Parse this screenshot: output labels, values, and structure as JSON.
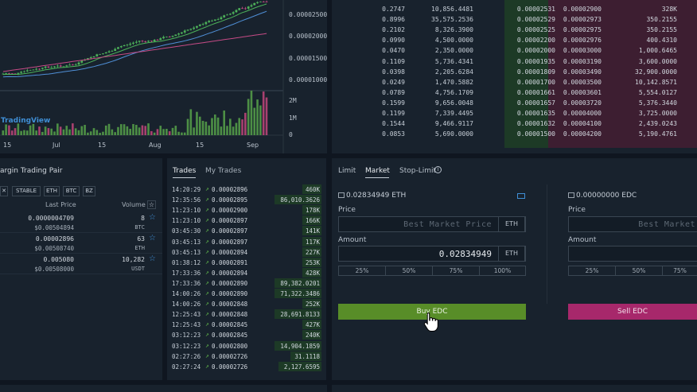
{
  "chart": {
    "y_axis": [
      "0.00002500",
      "0.00002000",
      "0.00001500",
      "0.00001000"
    ],
    "vol_axis": [
      "2M",
      "1M",
      "0"
    ],
    "x_axis": [
      "15",
      "Jul",
      "15",
      "Aug",
      "15",
      "Sep"
    ],
    "logo": "TradingView"
  },
  "orderbook": {
    "rows": [
      {
        "a": "0.2747",
        "b": "10,856.4481",
        "c": "0.00002531",
        "d": "0.00002900",
        "e": "328K"
      },
      {
        "a": "0.8996",
        "b": "35,575.2536",
        "c": "0.00002529",
        "d": "0.00002973",
        "e": "350.2155"
      },
      {
        "a": "0.2102",
        "b": "8,326.3900",
        "c": "0.00002525",
        "d": "0.00002975",
        "e": "350.2155"
      },
      {
        "a": "0.0990",
        "b": "4,500.0000",
        "c": "0.00002200",
        "d": "0.00002976",
        "e": "400.4310"
      },
      {
        "a": "0.0470",
        "b": "2,350.0000",
        "c": "0.00002000",
        "d": "0.00003000",
        "e": "1,000.6465"
      },
      {
        "a": "0.1109",
        "b": "5,736.4341",
        "c": "0.00001935",
        "d": "0.00003190",
        "e": "3,600.0000"
      },
      {
        "a": "0.0398",
        "b": "2,205.6284",
        "c": "0.00001809",
        "d": "0.00003490",
        "e": "32,900.0000"
      },
      {
        "a": "0.0249",
        "b": "1,470.5882",
        "c": "0.00001700",
        "d": "0.00003500",
        "e": "10,142.8571"
      },
      {
        "a": "0.0789",
        "b": "4,756.1709",
        "c": "0.00001661",
        "d": "0.00003601",
        "e": "5,554.0127"
      },
      {
        "a": "0.1599",
        "b": "9,656.0048",
        "c": "0.00001657",
        "d": "0.00003720",
        "e": "5,376.3440"
      },
      {
        "a": "0.1199",
        "b": "7,339.4495",
        "c": "0.00001635",
        "d": "0.00004000",
        "e": "3,725.0000"
      },
      {
        "a": "0.1544",
        "b": "9,466.9117",
        "c": "0.00001632",
        "d": "0.00004100",
        "e": "2,439.0243"
      },
      {
        "a": "0.0853",
        "b": "5,690.0000",
        "c": "0.00001500",
        "d": "0.00004200",
        "e": "5,190.4761"
      }
    ]
  },
  "pairs": {
    "title": "argin Trading Pair",
    "filters": [
      "STABLE",
      "ETH",
      "BTC",
      "BZ"
    ],
    "col_last": "Last Price",
    "col_volume": "Volume",
    "rows": [
      {
        "price": "0.0000004709",
        "usd": "$0.00504894",
        "vol": "8",
        "quote": "BTC"
      },
      {
        "price": "0.00002896",
        "usd": "$0.00508740",
        "vol": "63",
        "quote": "ETH"
      },
      {
        "price": "0.005080",
        "usd": "$0.00508000",
        "vol": "10,282",
        "quote": "USDT"
      }
    ]
  },
  "trades": {
    "tab_trades": "Trades",
    "tab_my": "My Trades",
    "rows": [
      {
        "time": "14:20:29",
        "price": "0.00002896",
        "vol": "460K"
      },
      {
        "time": "12:35:56",
        "price": "0.00002895",
        "vol": "86,010.3626"
      },
      {
        "time": "11:23:10",
        "price": "0.00002900",
        "vol": "178K"
      },
      {
        "time": "11:23:10",
        "price": "0.00002897",
        "vol": "166K"
      },
      {
        "time": "03:45:30",
        "price": "0.00002897",
        "vol": "141K"
      },
      {
        "time": "03:45:13",
        "price": "0.00002897",
        "vol": "117K"
      },
      {
        "time": "03:45:13",
        "price": "0.00002894",
        "vol": "227K"
      },
      {
        "time": "01:38:12",
        "price": "0.00002891",
        "vol": "253K"
      },
      {
        "time": "17:33:36",
        "price": "0.00002894",
        "vol": "428K"
      },
      {
        "time": "17:33:36",
        "price": "0.00002890",
        "vol": "89,382.0201"
      },
      {
        "time": "14:00:26",
        "price": "0.00002890",
        "vol": "71,322.3486"
      },
      {
        "time": "14:00:26",
        "price": "0.00002848",
        "vol": "252K"
      },
      {
        "time": "12:25:43",
        "price": "0.00002848",
        "vol": "28,691.8133"
      },
      {
        "time": "12:25:43",
        "price": "0.00002845",
        "vol": "427K"
      },
      {
        "time": "03:12:23",
        "price": "0.00002845",
        "vol": "240K"
      },
      {
        "time": "03:12:23",
        "price": "0.00002800",
        "vol": "14,904.1859"
      },
      {
        "time": "02:27:26",
        "price": "0.00002726",
        "vol": "31.1118"
      },
      {
        "time": "02:27:24",
        "price": "0.00002726",
        "vol": "2,127.6595"
      }
    ]
  },
  "order_form": {
    "tab_limit": "Limit",
    "tab_market": "Market",
    "tab_stop": "Stop-Limit",
    "buy": {
      "balance": "0.02834949 ETH",
      "price_label": "Price",
      "price_placeholder": "Best Market Price",
      "price_unit": "ETH",
      "amount_label": "Amount",
      "amount_value": "0.02834949",
      "amount_unit": "ETH",
      "pcts": [
        "25%",
        "50%",
        "75%",
        "100%"
      ],
      "button": "Buy EDC"
    },
    "sell": {
      "balance": "0.00000000 EDC",
      "price_label": "Price",
      "price_placeholder": "Best Market",
      "amount_label": "Amount",
      "pcts": [
        "25%",
        "50%",
        "75%"
      ],
      "button": "Sell EDC"
    }
  },
  "colors": {
    "buy_green": "#588d28",
    "sell_magenta": "#a7286b",
    "accent_blue": "#3f8fd6",
    "up_green": "#5fb54a"
  }
}
